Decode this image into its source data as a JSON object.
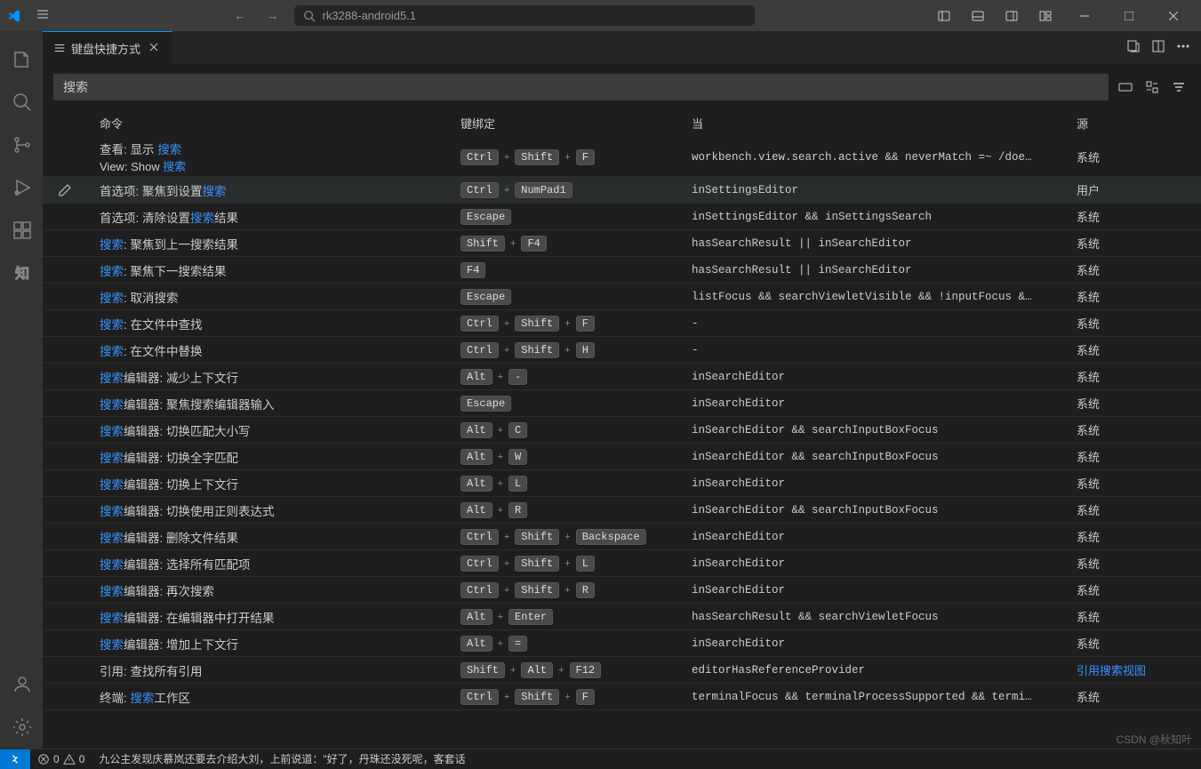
{
  "titlebar": {
    "searchText": "rk3288-android5.1"
  },
  "tab": {
    "label": "键盘快捷方式"
  },
  "search": {
    "value": "搜索"
  },
  "headers": {
    "cmd": "命令",
    "key": "键绑定",
    "when": "当",
    "src": "源"
  },
  "src": {
    "system": "系统",
    "user": "用户",
    "link": "引用搜索视图"
  },
  "rows": [
    {
      "tall": true,
      "cmd": [
        [
          "查看: 显示 "
        ],
        [
          "搜索",
          true
        ]
      ],
      "sub": [
        [
          "View: Show "
        ],
        [
          "搜索",
          true
        ]
      ],
      "keys": [
        "Ctrl",
        "Shift",
        "F"
      ],
      "when": "workbench.view.search.active && neverMatch =~ /doe…",
      "src": "system"
    },
    {
      "hover": true,
      "cmd": [
        [
          "首选项: 聚焦到设置"
        ],
        [
          "搜索",
          true
        ]
      ],
      "keys": [
        "Ctrl",
        "NumPad1"
      ],
      "when": "inSettingsEditor",
      "src": "user"
    },
    {
      "cmd": [
        [
          "首选项: 清除设置"
        ],
        [
          "搜索",
          true
        ],
        [
          "结果"
        ]
      ],
      "keys": [
        "Escape"
      ],
      "when": "inSettingsEditor && inSettingsSearch",
      "src": "system"
    },
    {
      "cmd": [
        [
          "搜索",
          true
        ],
        [
          ": 聚焦到上一搜索结果"
        ]
      ],
      "keys": [
        "Shift",
        "F4"
      ],
      "when": "hasSearchResult || inSearchEditor",
      "src": "system"
    },
    {
      "cmd": [
        [
          "搜索",
          true
        ],
        [
          ": 聚焦下一搜索结果"
        ]
      ],
      "keys": [
        "F4"
      ],
      "when": "hasSearchResult || inSearchEditor",
      "src": "system"
    },
    {
      "cmd": [
        [
          "搜索",
          true
        ],
        [
          ": 取消搜索"
        ]
      ],
      "keys": [
        "Escape"
      ],
      "when": "listFocus && searchViewletVisible && !inputFocus &…",
      "src": "system"
    },
    {
      "cmd": [
        [
          "搜索",
          true
        ],
        [
          ": 在文件中查找"
        ]
      ],
      "keys": [
        "Ctrl",
        "Shift",
        "F"
      ],
      "when": "-",
      "src": "system"
    },
    {
      "cmd": [
        [
          "搜索",
          true
        ],
        [
          ": 在文件中替换"
        ]
      ],
      "keys": [
        "Ctrl",
        "Shift",
        "H"
      ],
      "when": "-",
      "src": "system"
    },
    {
      "cmd": [
        [
          "搜索",
          true
        ],
        [
          "编辑器: 减少上下文行"
        ]
      ],
      "keys": [
        "Alt",
        "-"
      ],
      "when": "inSearchEditor",
      "src": "system"
    },
    {
      "cmd": [
        [
          "搜索",
          true
        ],
        [
          "编辑器: 聚焦搜索编辑器输入"
        ]
      ],
      "keys": [
        "Escape"
      ],
      "when": "inSearchEditor",
      "src": "system"
    },
    {
      "cmd": [
        [
          "搜索",
          true
        ],
        [
          "编辑器: 切换匹配大小写"
        ]
      ],
      "keys": [
        "Alt",
        "C"
      ],
      "when": "inSearchEditor && searchInputBoxFocus",
      "src": "system"
    },
    {
      "cmd": [
        [
          "搜索",
          true
        ],
        [
          "编辑器: 切换全字匹配"
        ]
      ],
      "keys": [
        "Alt",
        "W"
      ],
      "when": "inSearchEditor && searchInputBoxFocus",
      "src": "system"
    },
    {
      "cmd": [
        [
          "搜索",
          true
        ],
        [
          "编辑器: 切换上下文行"
        ]
      ],
      "keys": [
        "Alt",
        "L"
      ],
      "when": "inSearchEditor",
      "src": "system"
    },
    {
      "cmd": [
        [
          "搜索",
          true
        ],
        [
          "编辑器: 切换使用正则表达式"
        ]
      ],
      "keys": [
        "Alt",
        "R"
      ],
      "when": "inSearchEditor && searchInputBoxFocus",
      "src": "system"
    },
    {
      "cmd": [
        [
          "搜索",
          true
        ],
        [
          "编辑器: 删除文件结果"
        ]
      ],
      "keys": [
        "Ctrl",
        "Shift",
        "Backspace"
      ],
      "when": "inSearchEditor",
      "src": "system"
    },
    {
      "cmd": [
        [
          "搜索",
          true
        ],
        [
          "编辑器: 选择所有匹配项"
        ]
      ],
      "keys": [
        "Ctrl",
        "Shift",
        "L"
      ],
      "when": "inSearchEditor",
      "src": "system"
    },
    {
      "cmd": [
        [
          "搜索",
          true
        ],
        [
          "编辑器: 再次搜索"
        ]
      ],
      "keys": [
        "Ctrl",
        "Shift",
        "R"
      ],
      "when": "inSearchEditor",
      "src": "system"
    },
    {
      "cmd": [
        [
          "搜索",
          true
        ],
        [
          "编辑器: 在编辑器中打开结果"
        ]
      ],
      "keys": [
        "Alt",
        "Enter"
      ],
      "when": "hasSearchResult && searchViewletFocus",
      "src": "system"
    },
    {
      "cmd": [
        [
          "搜索",
          true
        ],
        [
          "编辑器: 增加上下文行"
        ]
      ],
      "keys": [
        "Alt",
        "="
      ],
      "when": "inSearchEditor",
      "src": "system"
    },
    {
      "cmd": [
        [
          "引用: 查找所有引用"
        ]
      ],
      "keys": [
        "Shift",
        "Alt",
        "F12"
      ],
      "when": "editorHasReferenceProvider",
      "src": "link"
    },
    {
      "cmd": [
        [
          "终端: "
        ],
        [
          "搜索",
          true
        ],
        [
          "工作区"
        ]
      ],
      "keys": [
        "Ctrl",
        "Shift",
        "F"
      ],
      "when": "terminalFocus && terminalProcessSupported && termi…",
      "src": "system"
    }
  ],
  "status": {
    "errors": "0",
    "warnings": "0",
    "text": "九公主发现庆慕岚还要去介绍大刘，上前说道：\"好了，丹珠还没死呢，客套话"
  },
  "watermark": "CSDN @秋知叶"
}
